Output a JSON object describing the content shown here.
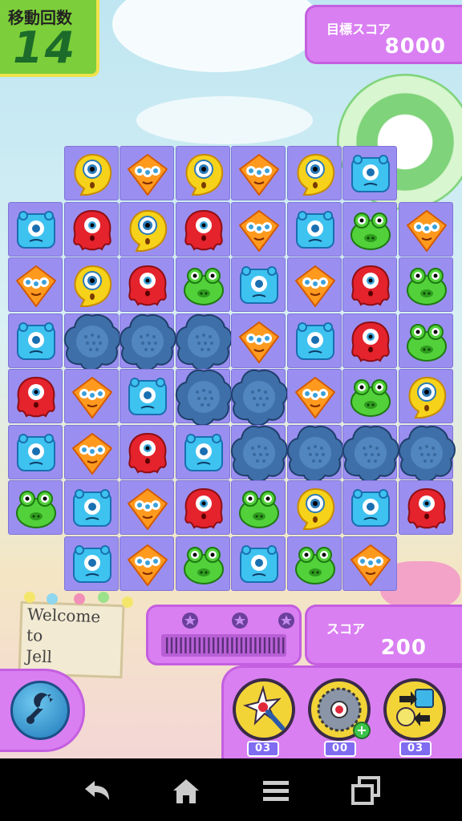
{
  "moves": {
    "label": "移動回数",
    "value": "14"
  },
  "target": {
    "label": "目標スコア",
    "value": "8000"
  },
  "score": {
    "label": "スコア",
    "value": "200"
  },
  "sign": {
    "lines": [
      "Welcome",
      "to",
      "Jell"
    ]
  },
  "boosters": [
    {
      "name": "magic-wand",
      "count": "03"
    },
    {
      "name": "saw-blade",
      "count": "00"
    },
    {
      "name": "swap",
      "count": "03"
    }
  ],
  "colors": {
    "purple": "#d97ff2",
    "board": "#9a8ff0",
    "moves_bg": "#7ccf3a"
  },
  "board": [
    [
      null,
      "Y",
      "O",
      "Y",
      "O",
      "Y",
      "B",
      null
    ],
    [
      "B",
      "R",
      "Y",
      "R",
      "O",
      "B",
      "G",
      "O"
    ],
    [
      "O",
      "Y",
      "R",
      "G",
      "B",
      "O",
      "R",
      "G"
    ],
    [
      "B",
      "X",
      "X",
      "X",
      "O",
      "B",
      "R",
      "G"
    ],
    [
      "R",
      "O",
      "B",
      "X",
      "X",
      "O",
      "G",
      "Y"
    ],
    [
      "B",
      "O",
      "R",
      "B",
      "X",
      "X",
      "X",
      "X"
    ],
    [
      "G",
      "B",
      "O",
      "R",
      "G",
      "Y",
      "B",
      "R"
    ],
    [
      null,
      "B",
      "O",
      "G",
      "B",
      "G",
      "O",
      null
    ]
  ],
  "nav": [
    "back-icon",
    "home-icon",
    "menu-icon",
    "recent-apps-icon"
  ]
}
